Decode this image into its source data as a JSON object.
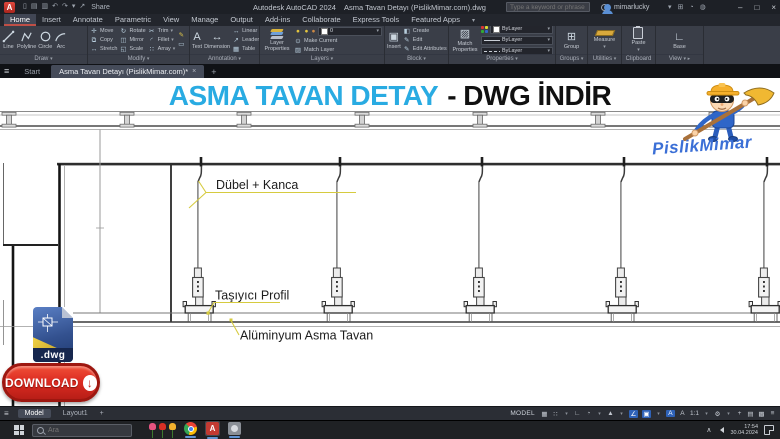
{
  "titlebar": {
    "logo": "A",
    "qat": [
      "▯",
      "▤",
      "▥",
      "↶",
      "↷",
      "▾"
    ],
    "share_icon": "↗",
    "share": "Share",
    "app_name": "Autodesk AutoCAD 2024",
    "doc_name": "Asma Tavan Detayı (PislikMimar.com).dwg",
    "search_placeholder": "Type a keyword or phrase",
    "user": "mimarlucky",
    "tray": [
      "▾",
      "⊞",
      "◔",
      "◍"
    ],
    "window": {
      "minimize": "–",
      "maximize": "□",
      "close": "×"
    }
  },
  "ribbon_tabs": [
    {
      "label": "Home",
      "cls": "active"
    },
    {
      "label": "Insert",
      "cls": ""
    },
    {
      "label": "Annotate",
      "cls": ""
    },
    {
      "label": "Parametric",
      "cls": ""
    },
    {
      "label": "View",
      "cls": ""
    },
    {
      "label": "Manage",
      "cls": ""
    },
    {
      "label": "Output",
      "cls": ""
    },
    {
      "label": "Add-ins",
      "cls": ""
    },
    {
      "label": "Collaborate",
      "cls": ""
    },
    {
      "label": "Express Tools",
      "cls": ""
    },
    {
      "label": "Featured Apps",
      "cls": ""
    }
  ],
  "ribbon": {
    "draw": {
      "title": "Draw",
      "line": "Line",
      "polyline": "Polyline",
      "circle": "Circle",
      "arc": "Arc"
    },
    "modify": {
      "title": "Modify",
      "move": "Move",
      "copy": "Copy",
      "stretch": "Stretch",
      "rotate": "Rotate",
      "mirror": "Mirror",
      "scale": "Scale",
      "trim": "Trim",
      "fillet": "Fillet",
      "array": "Array"
    },
    "annotation": {
      "title": "Annotation",
      "text": "Text",
      "dimension": "Dimension",
      "linear": "Linear",
      "leader": "Leader",
      "table": "Table"
    },
    "layers": {
      "title": "Layers",
      "properties": "Layer Properties",
      "current": "0",
      "make_current": "Make Current",
      "match_layer": "Match Layer"
    },
    "block": {
      "title": "Block",
      "insert": "Insert",
      "create": "Create",
      "edit": "Edit",
      "edit_attributes": "Edit Attributes"
    },
    "properties": {
      "title": "Properties",
      "match": "Match Properties",
      "bylayer": "ByLayer"
    },
    "groups": {
      "title": "Groups",
      "group": "Group"
    },
    "utilities": {
      "title": "Utilities",
      "measure": "Measure"
    },
    "clipboard": {
      "title": "Clipboard",
      "paste": "Paste"
    },
    "view": {
      "title": "View",
      "base": "Base"
    }
  },
  "glyphs": {
    "move": "✛",
    "copy": "⧉",
    "stretch": "↔",
    "rotate": "↻",
    "mirror": "◫",
    "scale": "◱",
    "trim": "✂",
    "fillet": "◜",
    "array": "∷",
    "pencil": "✎",
    "box": "▭",
    "text": "A",
    "dimension": "↔",
    "linear": "↔",
    "leader": "↗",
    "table": "▦",
    "insert": "▣",
    "create": "◧",
    "edit": "✎",
    "match": "▨",
    "group": "⊞",
    "base": "∟",
    "bulb": "●",
    "caret": "▾",
    "make_current": "⊙",
    "match_layer": "▨"
  },
  "doc_tabs": {
    "start": "Start",
    "active": "Asma Tavan Detayı (PislikMimar.com)*",
    "close": "×",
    "add": "+"
  },
  "canvas": {
    "heading": {
      "primary": "ASMA TAVAN DETAY",
      "secondary": "- DWG İNDİR"
    },
    "labels": {
      "hanger": "Dübel + Kanca",
      "carrier": "Taşıyıcı Profil",
      "ceiling": "Alüminyum Asma Tavan"
    },
    "signature": "PislikMimar",
    "file_badge": ".dwg",
    "download": "DOWNLOAD"
  },
  "statusbar": {
    "model": "Model",
    "layout": "Layout1",
    "add": "+",
    "mode": "MODEL",
    "icons": [
      {
        "g": "▦",
        "cls": ""
      },
      {
        "g": "∷",
        "cls": ""
      },
      {
        "g": "▾",
        "cls": "car"
      },
      {
        "g": "∟",
        "cls": ""
      },
      {
        "g": "◔",
        "cls": ""
      },
      {
        "g": "▾",
        "cls": "car"
      },
      {
        "g": "▲",
        "cls": ""
      },
      {
        "g": "▾",
        "cls": "car"
      },
      {
        "g": "∠",
        "cls": "hl"
      },
      {
        "g": "▣",
        "cls": "hl"
      },
      {
        "g": "▾",
        "cls": "car"
      },
      {
        "g": "A",
        "cls": "hl"
      },
      {
        "g": "A",
        "cls": ""
      },
      {
        "g": "1:1",
        "cls": ""
      },
      {
        "g": "▾",
        "cls": "car"
      },
      {
        "g": "⚙",
        "cls": ""
      },
      {
        "g": "▾",
        "cls": "car"
      },
      {
        "g": "+",
        "cls": ""
      },
      {
        "g": "▤",
        "cls": ""
      },
      {
        "g": "▩",
        "cls": ""
      },
      {
        "g": "≡",
        "cls": ""
      }
    ]
  },
  "taskbar": {
    "search_placeholder": "Ara",
    "acad": "A",
    "time": "17:54",
    "date": "30.04.2024",
    "chevron": "∧"
  },
  "colors": {
    "heading_blue": "#29abe2",
    "heading_dark": "#101010",
    "leader_yellow": "#d6cb3f",
    "download_red": "#d7231d",
    "signature_blue": "#3b6fd6",
    "accent_blue": "#2e62b8"
  }
}
